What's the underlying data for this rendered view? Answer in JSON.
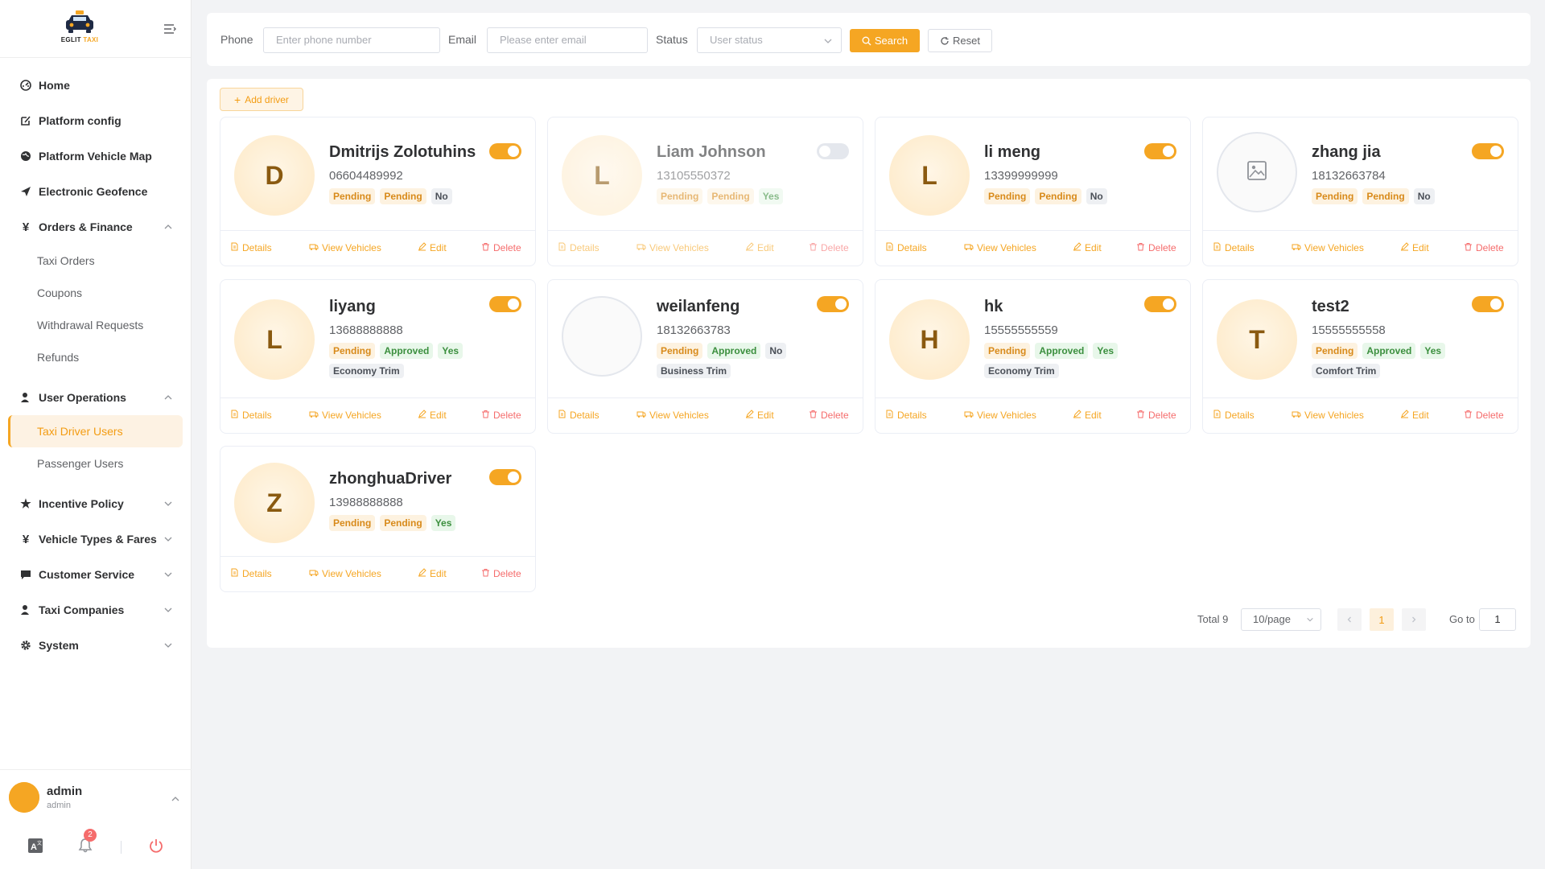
{
  "brand": {
    "logo_text_1": "EGLIT",
    "logo_text_2": "TAXI"
  },
  "sidebar": {
    "items": [
      {
        "label": "Home"
      },
      {
        "label": "Platform config"
      },
      {
        "label": "Platform Vehicle Map"
      },
      {
        "label": "Electronic Geofence"
      },
      {
        "label": "Orders & Finance"
      },
      {
        "label": "Taxi Orders"
      },
      {
        "label": "Coupons"
      },
      {
        "label": "Withdrawal Requests"
      },
      {
        "label": "Refunds"
      },
      {
        "label": "User Operations"
      },
      {
        "label": "Taxi Driver Users"
      },
      {
        "label": "Passenger Users"
      },
      {
        "label": "Incentive Policy"
      },
      {
        "label": "Vehicle Types & Fares"
      },
      {
        "label": "Customer Service"
      },
      {
        "label": "Taxi Companies"
      },
      {
        "label": "System"
      }
    ]
  },
  "user": {
    "name": "admin",
    "role": "admin",
    "notifications": "2"
  },
  "filter": {
    "phone_label": "Phone",
    "phone_placeholder": "Enter phone number",
    "email_label": "Email",
    "email_placeholder": "Please enter email",
    "status_label": "Status",
    "status_placeholder": "User status",
    "search_label": "Search",
    "reset_label": "Reset"
  },
  "add_driver_label": "Add driver",
  "actions": {
    "details": "Details",
    "view_vehicles": "View Vehicles",
    "edit": "Edit",
    "delete": "Delete"
  },
  "drivers": [
    {
      "initial": "D",
      "name": "Dmitrijs Zolotuhins",
      "phone": "06604489992",
      "tags": [
        "Pending",
        "Pending",
        "No"
      ],
      "trim": "",
      "enabled": true
    },
    {
      "initial": "L",
      "name": "Liam Johnson",
      "phone": "13105550372",
      "tags": [
        "Pending",
        "Pending",
        "Yes"
      ],
      "trim": "",
      "enabled": false
    },
    {
      "initial": "L",
      "name": "li meng",
      "phone": "13399999999",
      "tags": [
        "Pending",
        "Pending",
        "No"
      ],
      "trim": "",
      "enabled": true
    },
    {
      "initial": "",
      "name": "zhang jia",
      "phone": "18132663784",
      "tags": [
        "Pending",
        "Pending",
        "No"
      ],
      "trim": "",
      "enabled": true
    },
    {
      "initial": "L",
      "name": "liyang",
      "phone": "13688888888",
      "tags": [
        "Pending",
        "Approved",
        "Yes"
      ],
      "trim": "Economy Trim",
      "enabled": true
    },
    {
      "initial": "",
      "name": "weilanfeng",
      "phone": "18132663783",
      "tags": [
        "Pending",
        "Approved",
        "No"
      ],
      "trim": "Business Trim",
      "enabled": true
    },
    {
      "initial": "H",
      "name": "hk",
      "phone": "15555555559",
      "tags": [
        "Pending",
        "Approved",
        "Yes"
      ],
      "trim": "Economy Trim",
      "enabled": true
    },
    {
      "initial": "T",
      "name": "test2",
      "phone": "15555555558",
      "tags": [
        "Pending",
        "Approved",
        "Yes"
      ],
      "trim": "Comfort Trim",
      "enabled": true
    },
    {
      "initial": "Z",
      "name": "zhonghuaDriver",
      "phone": "13988888888",
      "tags": [
        "Pending",
        "Pending",
        "Yes"
      ],
      "trim": "",
      "enabled": true
    }
  ],
  "pagination": {
    "total": "Total 9",
    "page_size": "10/page",
    "current_page": "1",
    "goto_label": "Go to",
    "goto_value": "1"
  },
  "colors": {
    "accent": "#f5a623",
    "danger": "#f56c6c",
    "approved": "#3b8f3e"
  }
}
